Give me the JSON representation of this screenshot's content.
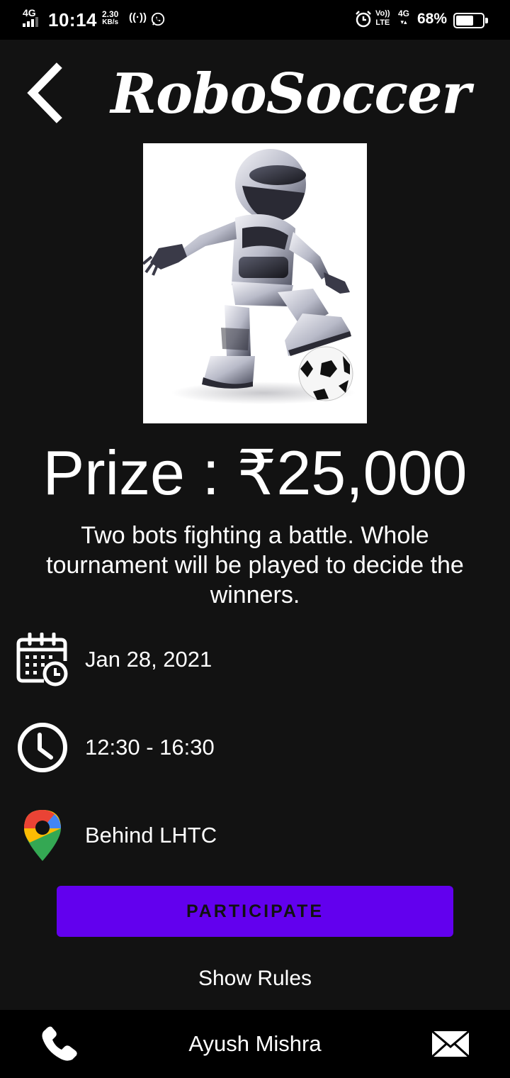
{
  "status_bar": {
    "network": "4G",
    "time": "10:14",
    "speed_value": "2.30",
    "speed_unit": "KB/s",
    "hotspot_icon": "hotspot-icon",
    "whatsapp_icon": "whatsapp-icon",
    "alarm_icon": "alarm-icon",
    "volte_top": "Vo))",
    "volte_bottom": "LTE",
    "data_type": "4G",
    "battery_percent": "68%",
    "battery_level": 0.68
  },
  "header": {
    "back_icon": "chevron-left-icon",
    "title": "RoboSoccer"
  },
  "event": {
    "image_icon": "robot-soccer-image",
    "prize": "Prize : ₹25,000",
    "description": "Two bots fighting a battle. Whole tournament will be played to decide the winners.",
    "date_icon": "calendar-clock-icon",
    "date": "Jan 28, 2021",
    "time_icon": "clock-icon",
    "time": "12:30 - 16:30",
    "location_icon": "map-pin-icon",
    "location": "Behind LHTC"
  },
  "actions": {
    "participate_label": "PARTICIPATE",
    "show_rules_label": "Show Rules"
  },
  "contact": {
    "call_icon": "phone-icon",
    "name": "Ayush Mishra",
    "mail_icon": "mail-icon"
  },
  "colors": {
    "background": "#121212",
    "bar": "#000000",
    "accent": "#6200ee",
    "text": "#ffffff"
  }
}
